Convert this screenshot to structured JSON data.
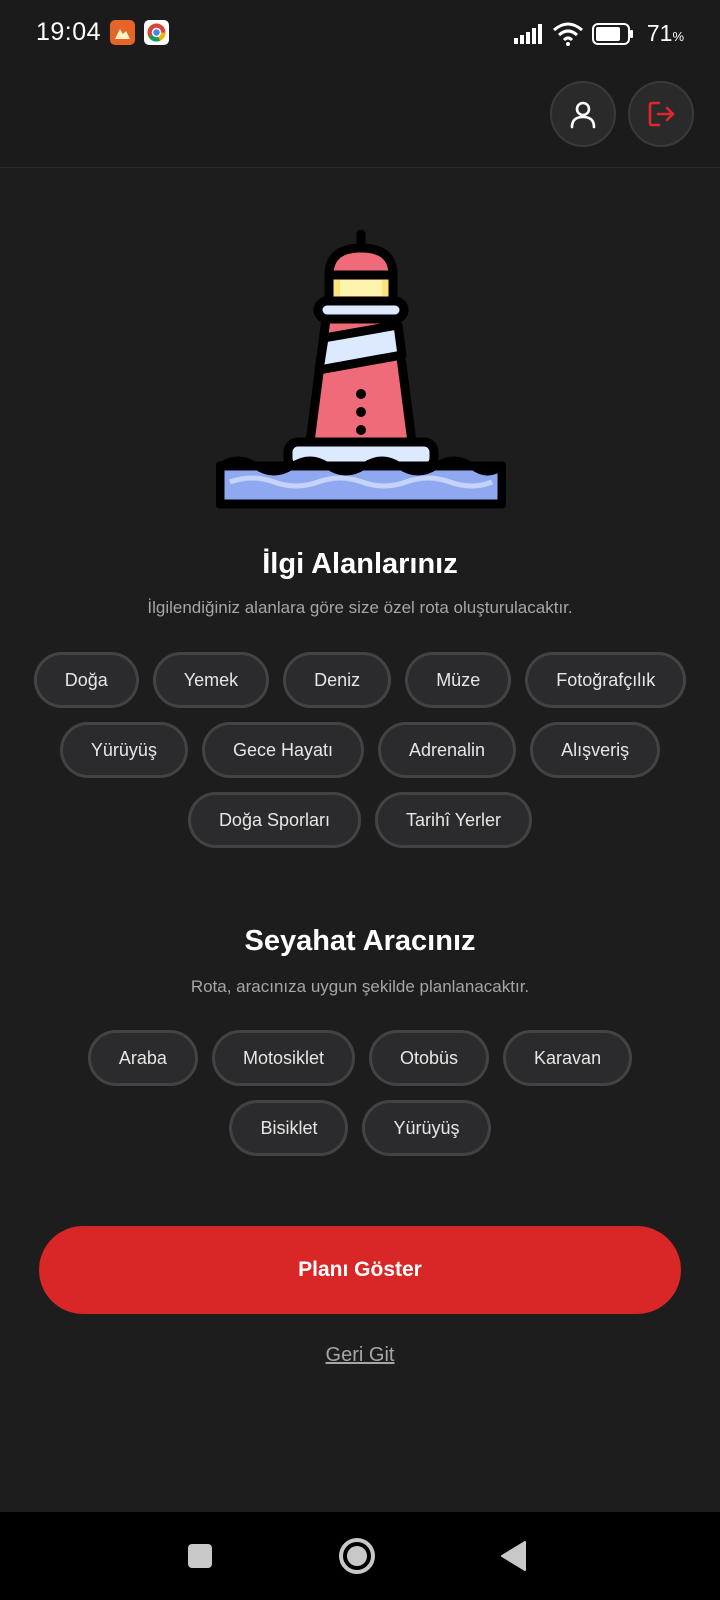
{
  "status_bar": {
    "time": "19:04",
    "battery_percent": "71",
    "battery_unit": "%",
    "icons": [
      "gallery-notification-icon",
      "chrome-notification-icon",
      "signal-icon",
      "wifi-icon",
      "battery-icon"
    ]
  },
  "header": {
    "profile_icon": "user-icon",
    "logout_icon": "logout-icon",
    "logout_color": "#e0262d"
  },
  "interests": {
    "title": "İlgi Alanlarınız",
    "subtitle": "İlgilendiğiniz alanlara göre size özel rota oluşturulacaktır.",
    "rows": [
      [
        "Doğa",
        "Yemek",
        "Deniz",
        "Müze",
        "Fotoğrafçılık"
      ],
      [
        "Yürüyüş",
        "Gece Hayatı",
        "Adrenalin",
        "Alışveriş"
      ],
      [
        "Doğa Sporları",
        "Tarihî Yerler"
      ]
    ]
  },
  "vehicle": {
    "title": "Seyahat Aracınız",
    "subtitle": "Rota, aracınıza uygun şekilde planlanacaktır.",
    "rows": [
      [
        "Araba",
        "Motosiklet",
        "Otobüs",
        "Karavan"
      ],
      [
        "Bisiklet",
        "Yürüyüş"
      ]
    ]
  },
  "actions": {
    "show_plan": "Planı Göster",
    "go_back": "Geri Git",
    "accent_color": "#d92626"
  },
  "nav_bar": {
    "icons": [
      "recents-icon",
      "home-icon",
      "back-icon"
    ]
  }
}
